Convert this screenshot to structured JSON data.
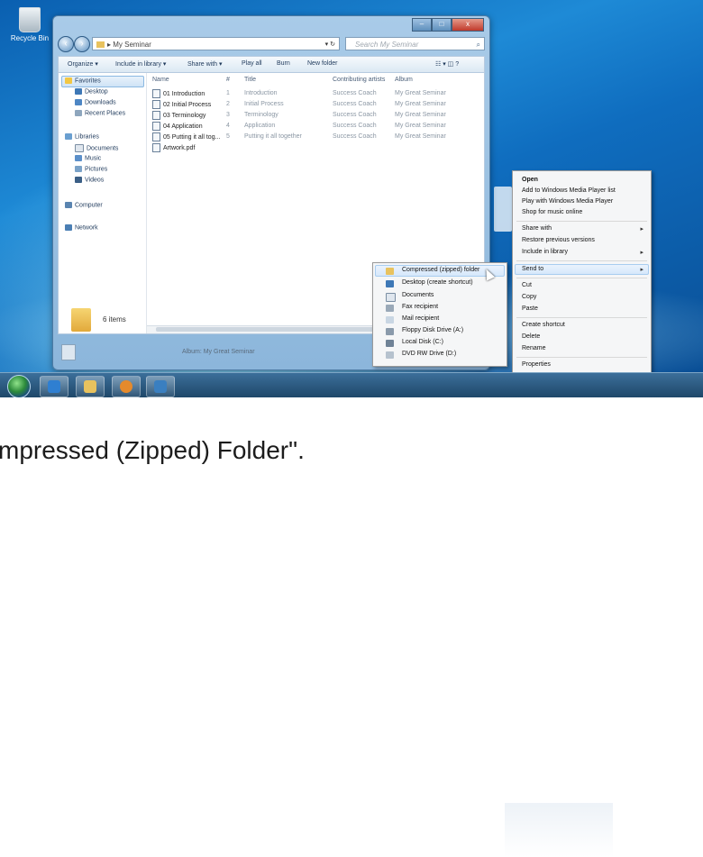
{
  "desktop": {
    "recycle_label": "Recycle Bin"
  },
  "explorer": {
    "window_controls": {
      "minimize": "–",
      "maximize": "□",
      "close": "x"
    },
    "address": "▸ My Seminar",
    "address_controls": "▾ ↻",
    "search_placeholder": "Search My Seminar",
    "toolbar": [
      "Organize ▾",
      "Include in library ▾",
      "Share with ▾",
      "Play all",
      "Burn",
      "New folder"
    ],
    "toolbar_right": "☷ ▾  ◫  ?",
    "nav": {
      "favorites": "Favorites",
      "favorites_items": [
        "Desktop",
        "Downloads",
        "Recent Places"
      ],
      "libraries": "Libraries",
      "libraries_items": [
        "Documents",
        "Music",
        "Pictures",
        "Videos"
      ],
      "computer": "Computer",
      "network": "Network"
    },
    "columns": [
      "Name",
      "#",
      "Title",
      "Contributing artists",
      "Album"
    ],
    "rows": [
      {
        "name": "01 Introduction",
        "num": "1",
        "title": "Introduction",
        "artist": "Success Coach",
        "album": "My Great Seminar"
      },
      {
        "name": "02 Initial Process",
        "num": "2",
        "title": "Initial Process",
        "artist": "Success Coach",
        "album": "My Great Seminar"
      },
      {
        "name": "03 Terminology",
        "num": "3",
        "title": "Terminology",
        "artist": "Success Coach",
        "album": "My Great Seminar"
      },
      {
        "name": "04 Application",
        "num": "4",
        "title": "Application",
        "artist": "Success Coach",
        "album": "My Great Seminar"
      },
      {
        "name": "05 Putting it all tog...",
        "num": "5",
        "title": "Putting it all together",
        "artist": "Success Coach",
        "album": "My Great Seminar"
      },
      {
        "name": "Artwork.pdf",
        "num": "",
        "title": "",
        "artist": "",
        "album": ""
      }
    ],
    "status_count": "6 items",
    "details_album": "Album: My Great Seminar"
  },
  "context_menu": {
    "items": [
      "Open",
      "Add to Windows Media Player list",
      "Play with Windows Media Player",
      "Shop for music online",
      "Share with",
      "Restore previous versions",
      "Include in library",
      "Send to",
      "Cut",
      "Copy",
      "Paste",
      "Create shortcut",
      "Delete",
      "Rename",
      "Properties"
    ]
  },
  "send_to_menu": {
    "items": [
      "Compressed (zipped) folder",
      "Desktop (create shortcut)",
      "Documents",
      "Fax recipient",
      "Mail recipient",
      "Floppy Disk Drive (A:)",
      "Local Disk (C:)",
      "DVD RW Drive (D:)"
    ]
  },
  "caption": "mpressed (Zipped) Folder\".",
  "colors": {
    "accent": "#1e8ad6",
    "highlight": "#d6e8fb"
  }
}
